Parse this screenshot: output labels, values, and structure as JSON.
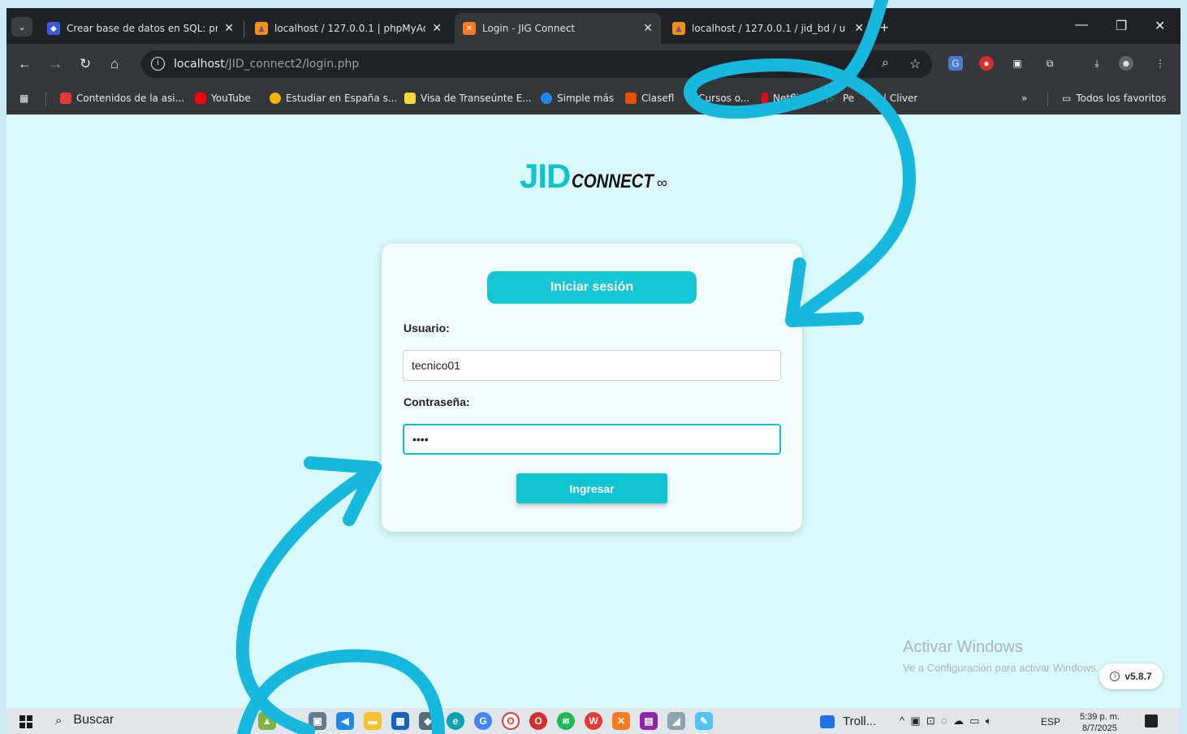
{
  "browser": {
    "tabs": [
      {
        "title": "Crear base de datos en SQL: pri",
        "icon": "deepseek-icon",
        "active": false
      },
      {
        "title": "localhost / 127.0.0.1 | phpMyAd",
        "icon": "phpmyadmin-icon",
        "active": false
      },
      {
        "title": "Login - JIG Connect",
        "icon": "xampp-icon",
        "active": true
      },
      {
        "title": "localhost / 127.0.0.1 / jid_bd / u",
        "icon": "phpmyadmin-icon",
        "active": false
      }
    ],
    "url_host": "localhost",
    "url_path": "/JID_connect2/login.php",
    "bookmarks": [
      "Contenidos de la asi...",
      "YouTube",
      "Estudiar en España s...",
      "Visa de Transeúnte E...",
      "Simple más",
      "Clasefl",
      "- Cursos o...",
      "Netflix",
      "Pe",
      "| Cliver"
    ],
    "all_bookmarks": "Todos los favoritos",
    "more_bookmarks": "»"
  },
  "page": {
    "logo_main": "JID",
    "logo_sub": "CONNECT",
    "logo_symbol": "∞",
    "login": {
      "title": "Iniciar sesión",
      "user_label": "Usuario:",
      "user_value": "tecnico01",
      "pass_label": "Contraseña:",
      "pass_value": "••••",
      "submit_label": "Ingresar"
    },
    "watermark_title": "Activar Windows",
    "watermark_sub": "Ve a Configuración para activar Windows.",
    "version": "v5.8.7"
  },
  "taskbar": {
    "search_label": "Buscar",
    "running_app": "Troll...",
    "language": "ESP",
    "time": "5:39 p. m.",
    "date": "8/7/2025"
  },
  "colors": {
    "accent": "#10c3d2",
    "page_bg": "#d9fbfd",
    "frame_bg": "#cfe9f6",
    "arrow": "#16b8de"
  }
}
